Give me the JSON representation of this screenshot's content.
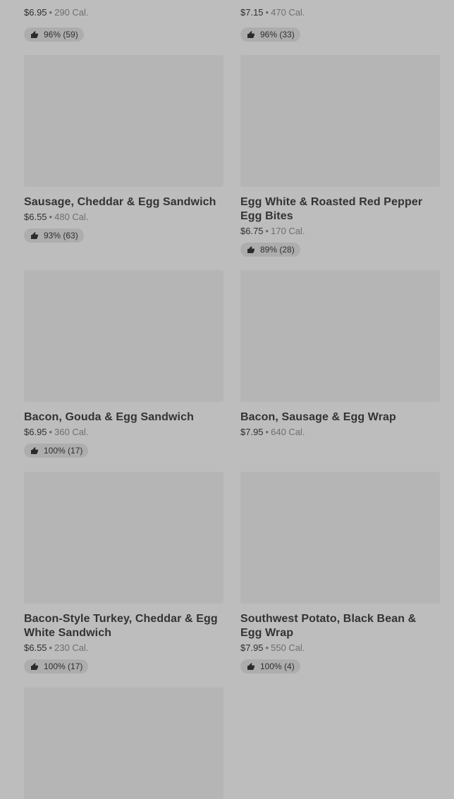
{
  "top_row": [
    {
      "price": "$6.95",
      "cal": "290 Cal.",
      "rating": "96% (59)"
    },
    {
      "price": "$7.15",
      "cal": "470 Cal.",
      "rating": "96% (33)"
    }
  ],
  "items": [
    {
      "name": "Sausage, Cheddar & Egg Sandwich",
      "price": "$6.55",
      "cal": "480 Cal.",
      "rating": "93% (63)"
    },
    {
      "name": "Egg White & Roasted Red Pepper Egg Bites",
      "price": "$6.75",
      "cal": "170 Cal.",
      "rating": "89% (28)"
    },
    {
      "name": "Bacon, Gouda & Egg Sandwich",
      "price": "$6.95",
      "cal": "360 Cal.",
      "rating": "100% (17)"
    },
    {
      "name": "Bacon, Sausage & Egg Wrap",
      "price": "$7.95",
      "cal": "640 Cal."
    },
    {
      "name": "Bacon-Style Turkey, Cheddar & Egg White Sandwich",
      "price": "$6.55",
      "cal": "230 Cal.",
      "rating": "100% (17)"
    },
    {
      "name": "Southwest Potato, Black Bean & Egg Wrap",
      "price": "$7.95",
      "cal": "550 Cal.",
      "rating": "100% (4)"
    }
  ],
  "icons": {
    "rating": "thumbs-up-icon"
  }
}
